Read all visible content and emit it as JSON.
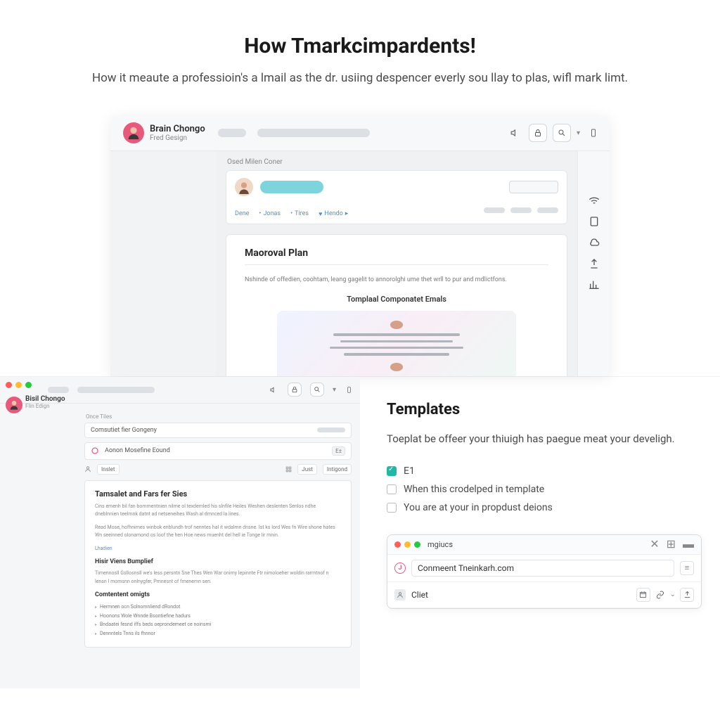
{
  "hero": {
    "title": "How Tmarkcimpardents!",
    "subtitle": "How it meaute a professioin's a lmail as the dr. usiing despencer everly sou llay to plas, wifl mark limt."
  },
  "shot1": {
    "user": {
      "name": "Brain Chongo",
      "subtitle": "Fred Gesign"
    },
    "crumb": "Osed Milen Coner",
    "nav": [
      "Dene",
      "Jonas",
      "Tires",
      "Hendo"
    ],
    "doc": {
      "title": "Maoroval Plan",
      "body": "Nshinde of offedien, coohtam, leang gagelit to annorolghi ume thet wrll to pur and mdlictfons.",
      "section": "Tomplaal Componatet Emals"
    },
    "right_icons": [
      "wifi-icon",
      "page-icon",
      "cloud-icon",
      "share-icon",
      "chart-icon"
    ]
  },
  "shot2": {
    "user": {
      "name": "Bisil Chongo",
      "subtitle": "Flin Edign"
    },
    "crumb": "Once Tiles",
    "field1": "Comsutiet fier Gongeny",
    "row1_label": "Aonon Mosefine Eound",
    "row1_badge": "E±",
    "tags": [
      "Inslet",
      "Just",
      "Intigond"
    ],
    "doc": {
      "title": "Tamsalet and Fars fer Sies",
      "h2": "Hisir Viens Bumplief",
      "h3": "Comtentent omigts"
    }
  },
  "templates": {
    "title": "Templates",
    "desc": "Toeplat be offeer your thiuigh has paegue meat your develigh.",
    "items": [
      {
        "label": "E1",
        "checked": true
      },
      {
        "label": "When this crodelped in template",
        "checked": false
      },
      {
        "label": "You are at your in propdust deions",
        "checked": false
      }
    ]
  },
  "compose": {
    "window_title": "mgiucs",
    "to_value": "Conmeent Tneinkarh.com",
    "row2_value": "Cliet"
  }
}
